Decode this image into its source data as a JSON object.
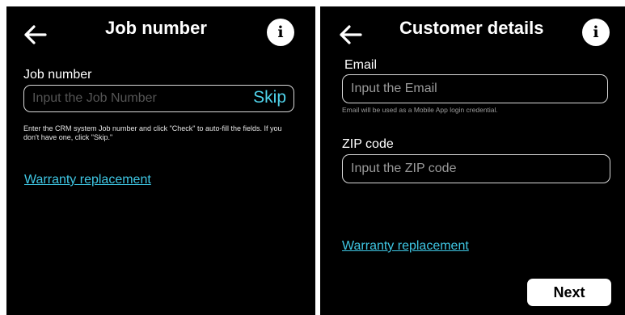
{
  "job_screen": {
    "title": "Job number",
    "info_glyph": "i",
    "field_label": "Job number",
    "input_placeholder": "Input the  Job Number",
    "skip_label": "Skip",
    "help_text": "Enter the CRM system Job number and click \"Check\" to auto-fill the fields.  If you don't have one, click \"Skip.\"",
    "warranty_link": "Warranty replacement"
  },
  "customer_screen": {
    "title": "Customer details",
    "info_glyph": "i",
    "email_label": "Email",
    "email_placeholder": "Input the Email",
    "email_help": "Email will be used as a Mobile App login credential.",
    "zip_label": "ZIP code",
    "zip_placeholder": "Input the ZIP code",
    "warranty_link": "Warranty replacement",
    "next_label": "Next"
  },
  "colors": {
    "background": "#000000",
    "link": "#3fc7e4",
    "skip": "#4fd2ea",
    "placeholder_job": "#555555",
    "placeholder_customer": "#9a9a9a"
  },
  "icons": {
    "back": "arrow-left-icon",
    "info": "info-icon"
  }
}
